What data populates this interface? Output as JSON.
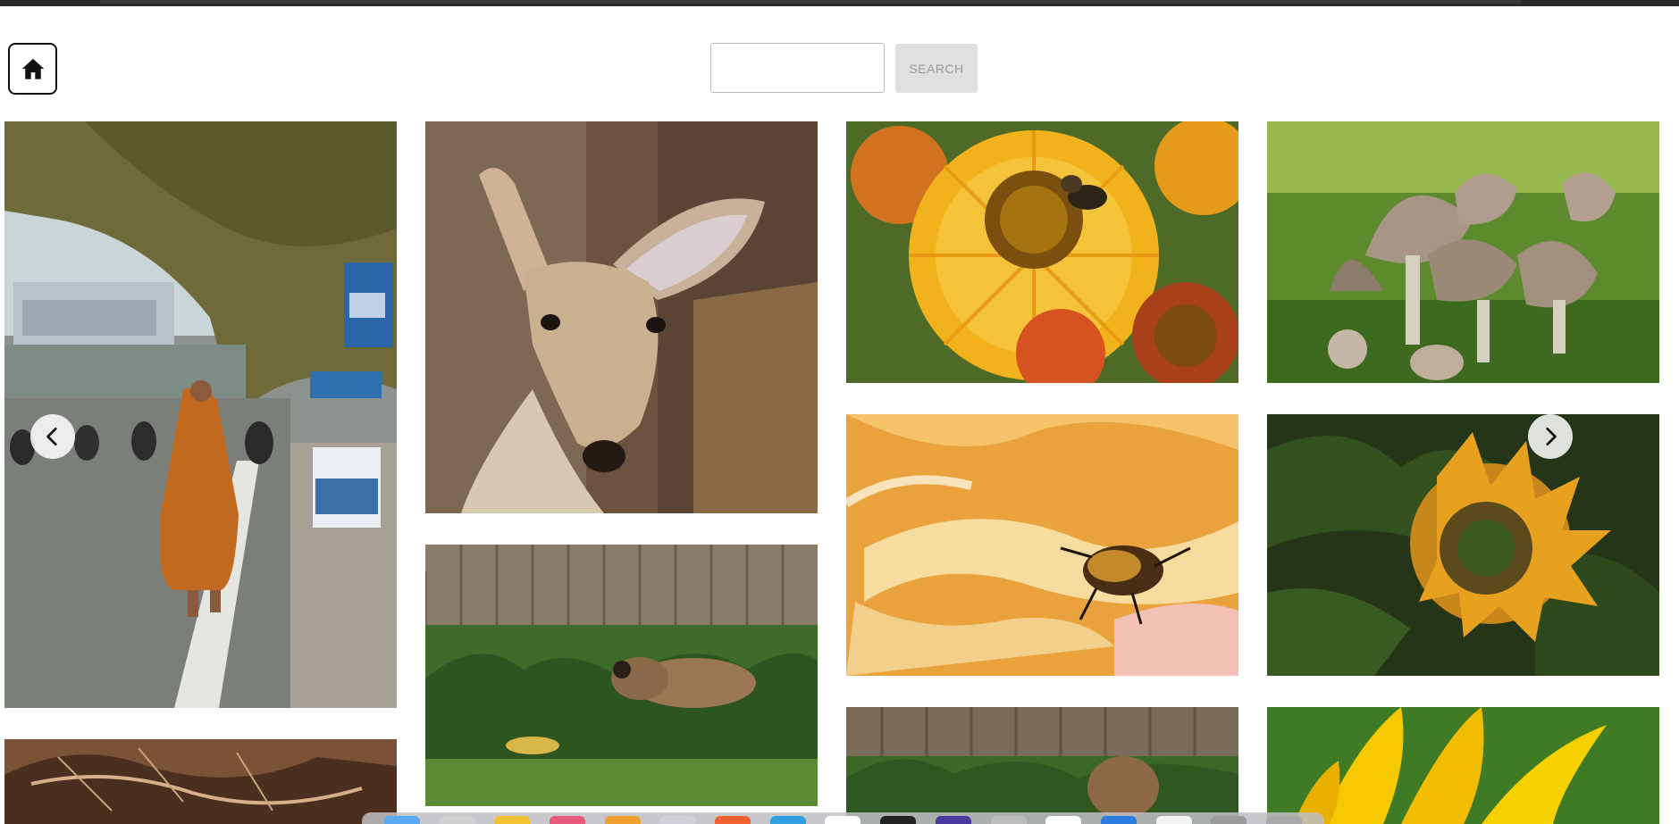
{
  "header": {
    "home_icon": "home-icon",
    "search": {
      "value": "",
      "placeholder": ""
    },
    "search_button_label": "SEARCH"
  },
  "gallery": {
    "tiles": [
      {
        "subject": "street-scene-with-monk"
      },
      {
        "subject": "deer"
      },
      {
        "subject": "flower-with-bee"
      },
      {
        "subject": "mushrooms"
      },
      {
        "subject": "beetle-on-rose"
      },
      {
        "subject": "sunflower"
      },
      {
        "subject": "squirrel"
      },
      {
        "subject": "turkey-feathers"
      },
      {
        "subject": "squirrel-partial"
      },
      {
        "subject": "yellow-petals"
      }
    ],
    "prev_icon": "chevron-left-icon",
    "next_icon": "chevron-right-icon"
  },
  "colors": {
    "window_bar": "#2b2b2d",
    "search_button_bg": "#e0e0e0",
    "search_button_text": "#9a9a9a"
  }
}
